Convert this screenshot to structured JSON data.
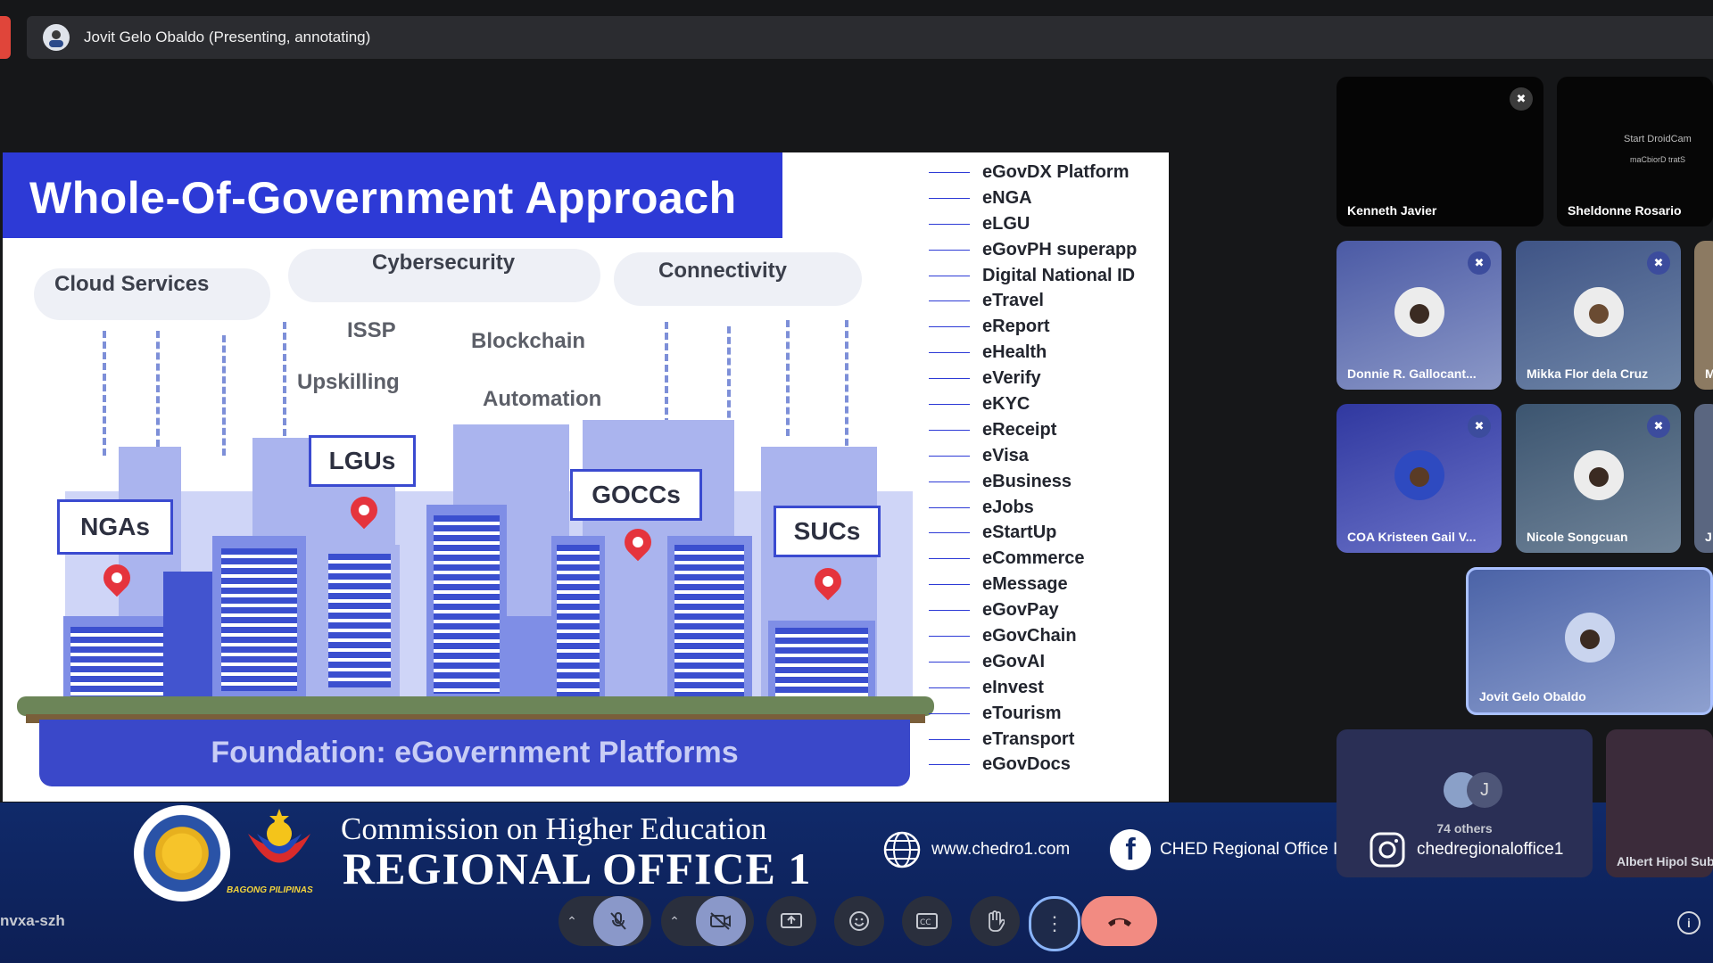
{
  "presenter_bar": {
    "label": "Jovit Gelo Obaldo (Presenting, annotating)"
  },
  "slide": {
    "title": "Whole-Of-Government Approach",
    "clouds": [
      "Cloud Services",
      "Cybersecurity",
      "Connectivity"
    ],
    "middle_terms": [
      "ISSP",
      "Upskilling",
      "Blockchain",
      "Automation"
    ],
    "agencies": [
      "NGAs",
      "LGUs",
      "GOCCs",
      "SUCs"
    ],
    "foundation": "Foundation: eGovernment Platforms",
    "platforms": [
      "eGovDX Platform",
      "eNGA",
      "eLGU",
      "eGovPH  superapp",
      "Digital  National  ID",
      "eTravel",
      "eReport",
      "eHealth",
      "eVerify",
      "eKYC",
      "eReceipt",
      "eVisa",
      "eBusiness",
      "eJobs",
      "eStartUp",
      "eCommerce",
      "eMessage",
      "eGovPay",
      "eGovChain",
      "eGovAI",
      "eInvest",
      "eTourism",
      "eTransport",
      "eGovDocs"
    ]
  },
  "participants": {
    "kenneth": "Kenneth Javier",
    "sheldonne": "Sheldonne Rosario",
    "sheldonne_overlay1": "Start DroidCam",
    "sheldonne_overlay2": "maCbiorD tratS",
    "donnie": "Donnie R. Gallocant...",
    "mikka": "Mikka Flor dela Cruz",
    "cut_row2": "M",
    "coa": "COA Kristeen Gail V...",
    "nicole": "Nicole Songcuan",
    "cut_row3": "J",
    "jovit": "Jovit Gelo Obaldo",
    "others_initial": "J",
    "others_count": "74 others",
    "albert": "Albert Hipol Sub"
  },
  "branding": {
    "line1": "Commission on Higher Education",
    "line2": "REGIONAL OFFICE 1",
    "bagong": "BAGONG PILIPINAS",
    "website": "www.chedro1.com",
    "facebook": "CHED Regional Office I",
    "instagram": "chedregionaloffice1"
  },
  "controls": {
    "meeting_code": "nvxa-szh"
  },
  "colors": {
    "slide_blue": "#2d3ad6",
    "end_call": "#f28b82",
    "banner": "#102a6a"
  }
}
